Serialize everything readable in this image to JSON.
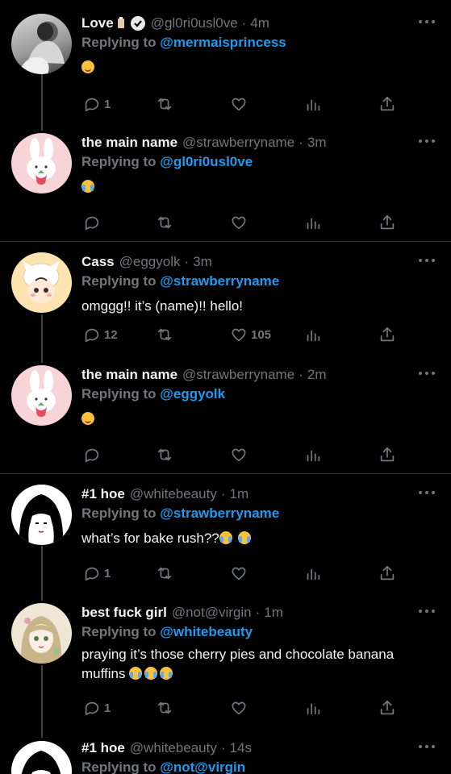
{
  "tweets": [
    {
      "name": "Love",
      "handle": "@gl0ri0usl0ve",
      "time": "4m",
      "replying_label": "Replying to",
      "reply_to": "@mermaisprincess",
      "text": "",
      "reply_count": "1",
      "like_count": "",
      "avatar": "photo",
      "verified": true
    },
    {
      "name": "the main name",
      "handle": "@strawberryname",
      "time": "3m",
      "replying_label": "Replying to",
      "reply_to": "@gl0ri0usl0ve",
      "text": "",
      "reply_count": "",
      "like_count": "",
      "avatar": "bunny"
    },
    {
      "name": "Cass",
      "handle": "@eggyolk",
      "time": "3m",
      "replying_label": "Replying to",
      "reply_to": "@strawberryname",
      "text": "omggg!! it’s (name)!! hello!",
      "reply_count": "12",
      "like_count": "105",
      "avatar": "cat"
    },
    {
      "name": "the main name",
      "handle": "@strawberryname",
      "time": "2m",
      "replying_label": "Replying to",
      "reply_to": "@eggyolk",
      "text": "",
      "reply_count": "",
      "like_count": "",
      "avatar": "bunny"
    },
    {
      "name": "#1 hoe",
      "handle": "@whitebeauty",
      "time": "1m",
      "replying_label": "Replying to",
      "reply_to": "@strawberryname",
      "text": "what’s for bake rush??",
      "reply_count": "1",
      "like_count": "",
      "avatar": "manga"
    },
    {
      "name": "best fuck girl",
      "handle": "@not@virgin",
      "time": "1m",
      "replying_label": "Replying to",
      "reply_to": "@whitebeauty",
      "text": "praying it’s those cherry pies and chocolate banana muffins",
      "reply_count": "1",
      "like_count": "",
      "avatar": "doll"
    },
    {
      "name": "#1 hoe",
      "handle": "@whitebeauty",
      "time": "14s",
      "replying_label": "Replying to",
      "reply_to": "@not@virgin",
      "text": "",
      "avatar": "manga"
    }
  ],
  "icons": {
    "reply": "reply-icon",
    "retweet": "retweet-icon",
    "like": "heart-icon",
    "views": "analytics-icon",
    "share": "share-icon",
    "more": "more-icon",
    "verified": "verified-badge-icon"
  },
  "colors": {
    "background": "#000000",
    "accent": "#1d9bf0",
    "muted": "#71767b",
    "divider": "#2f3336"
  }
}
